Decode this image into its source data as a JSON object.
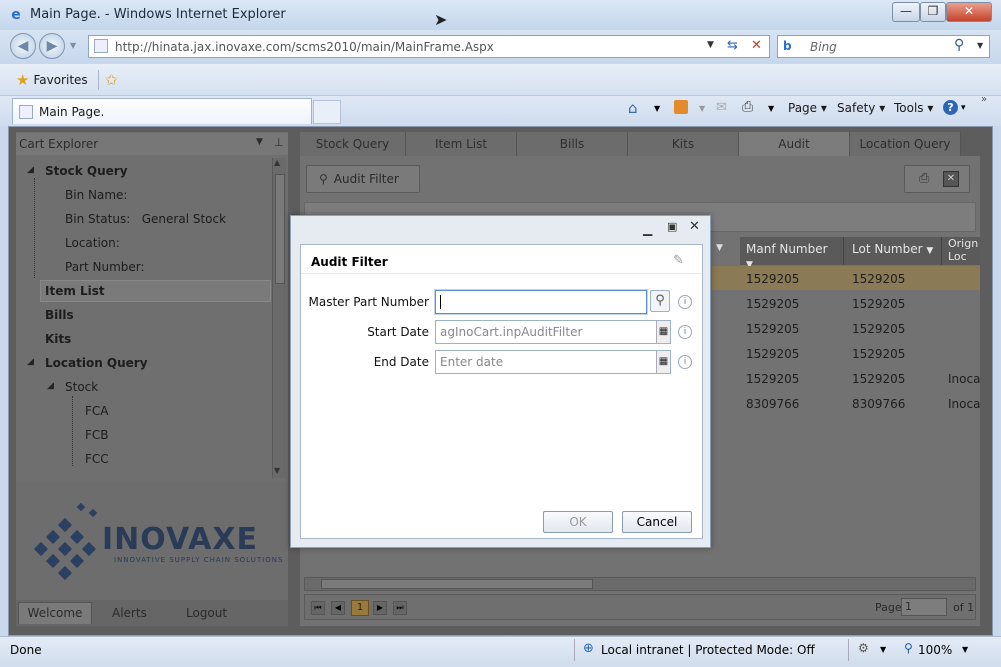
{
  "window": {
    "title": "Main Page. - Windows Internet Explorer",
    "minimize": "—",
    "maximize": "❐",
    "close": "✕"
  },
  "address": {
    "url": "http://hinata.jax.inovaxe.com/scms2010/main/MainFrame.Aspx",
    "search_placeholder": "Bing"
  },
  "favorites": {
    "label": "Favorites"
  },
  "tab": {
    "label": "Main Page."
  },
  "commands": {
    "page": "Page",
    "safety": "Safety",
    "tools": "Tools",
    "help": "?"
  },
  "cart_explorer": {
    "title": "Cart Explorer",
    "tree": {
      "stock_query": "Stock Query",
      "bin_name": "Bin Name:",
      "bin_status_label": "Bin Status:",
      "bin_status_value": "General Stock",
      "location": "Location:",
      "part_number": "Part Number:",
      "item_list": "Item List",
      "bills": "Bills",
      "kits": "Kits",
      "location_query": "Location Query",
      "stock": "Stock",
      "fca": "FCA",
      "fcb": "FCB",
      "fcc": "FCC"
    },
    "logo_text": "INOVAXE",
    "logo_tagline": "Innovative Supply Chain Solutions",
    "bottom_tabs": [
      "Welcome",
      "Alerts",
      "Logout"
    ]
  },
  "main_tabs": [
    "Stock Query",
    "Item List",
    "Bills",
    "Kits",
    "Audit",
    "Location Query"
  ],
  "toolbar": {
    "audit_filter": "Audit Filter"
  },
  "grid": {
    "columns": [
      "Manf Number",
      "Lot Number",
      "Orign Loc"
    ],
    "rows": [
      [
        "1529205",
        "1529205",
        ""
      ],
      [
        "1529205",
        "1529205",
        ""
      ],
      [
        "1529205",
        "1529205",
        ""
      ],
      [
        "1529205",
        "1529205",
        ""
      ],
      [
        "1529205",
        "1529205",
        "Inoca"
      ],
      [
        "8309766",
        "8309766",
        "Inoca"
      ]
    ]
  },
  "pager": {
    "current": "1",
    "page_label": "Page",
    "page_value": "1",
    "of_label": "of 1"
  },
  "dialog": {
    "title": "Audit Filter",
    "fields": {
      "master_part_label": "Master Part Number",
      "master_part_value": "",
      "start_date_label": "Start Date",
      "start_date_value": "agInoCart.inpAuditFilter",
      "end_date_label": "End Date",
      "end_date_placeholder": "Enter date"
    },
    "ok": "OK",
    "cancel": "Cancel"
  },
  "status": {
    "left": "Done",
    "zone": "Local intranet | Protected Mode: Off",
    "zoom": "100%"
  }
}
